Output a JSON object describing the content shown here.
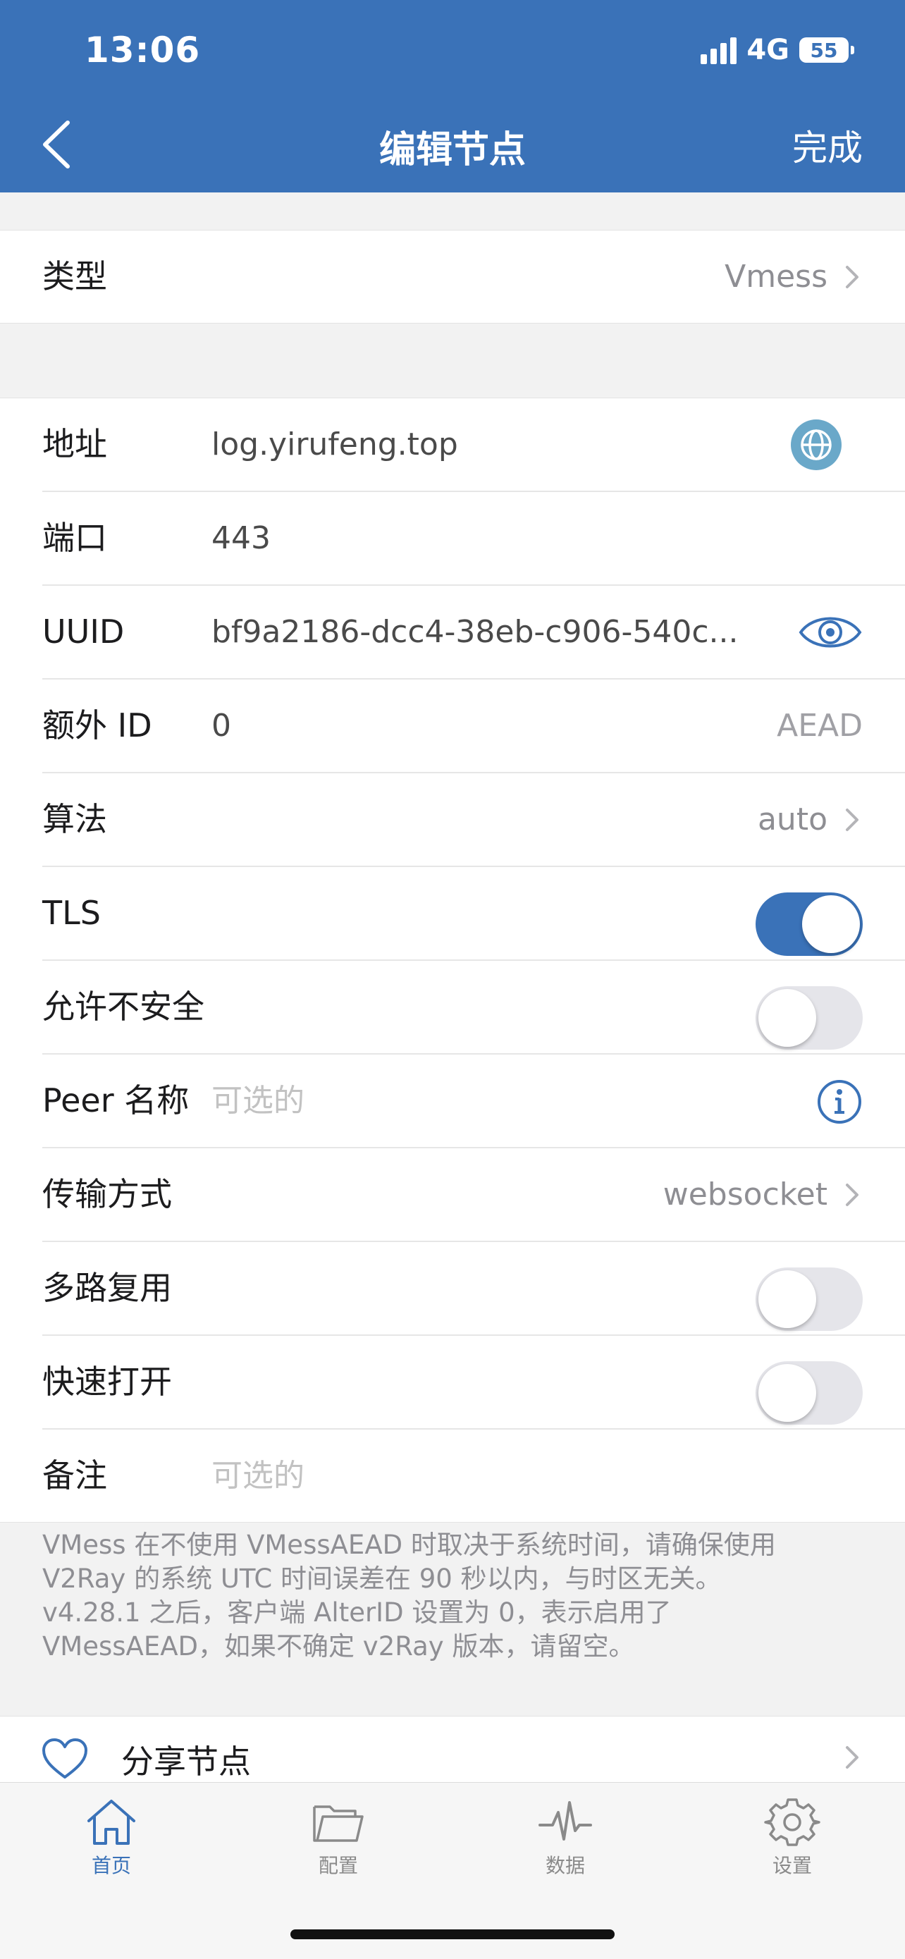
{
  "status": {
    "time": "13:06",
    "network": "4G",
    "battery": "55"
  },
  "nav": {
    "title": "编辑节点",
    "done_label": "完成"
  },
  "type_row": {
    "label": "类型",
    "value": "Vmess"
  },
  "fields": {
    "address": {
      "label": "地址",
      "value": "log.yirufeng.top"
    },
    "port": {
      "label": "端口",
      "value": "443"
    },
    "uuid": {
      "label": "UUID",
      "value": "bf9a2186-dcc4-38eb-c906-540c..."
    },
    "alter_id": {
      "label": "额外 ID",
      "value": "0",
      "hint": "AEAD"
    },
    "cipher": {
      "label": "算法",
      "value": "auto"
    },
    "tls": {
      "label": "TLS",
      "on": true
    },
    "allow_insecure": {
      "label": "允许不安全",
      "on": false
    },
    "peer": {
      "label": "Peer 名称",
      "placeholder": "可选的"
    },
    "transport": {
      "label": "传输方式",
      "value": "websocket"
    },
    "mux": {
      "label": "多路复用",
      "on": false
    },
    "fast_open": {
      "label": "快速打开",
      "on": false
    },
    "remark": {
      "label": "备注",
      "placeholder": "可选的"
    }
  },
  "note": {
    "line1": "VMess 在不使用 VMessAEAD 时取决于系统时间，请确保使用",
    "line2": "V2Ray 的系统 UTC 时间误差在 90 秒以内，与时区无关。",
    "line3": "v4.28.1 之后，客户端 AlterID 设置为 0，表示启用了",
    "line4": "VMessAEAD，如果不确定 v2Ray 版本，请留空。"
  },
  "share": {
    "label": "分享节点"
  },
  "tabs": [
    {
      "label": "首页",
      "icon": "home-icon",
      "active": true
    },
    {
      "label": "配置",
      "icon": "folder-icon",
      "active": false
    },
    {
      "label": "数据",
      "icon": "pulse-icon",
      "active": false
    },
    {
      "label": "设置",
      "icon": "gear-icon",
      "active": false
    }
  ],
  "colors": {
    "accent": "#3a72b8",
    "globe": "#6aa8c9"
  }
}
